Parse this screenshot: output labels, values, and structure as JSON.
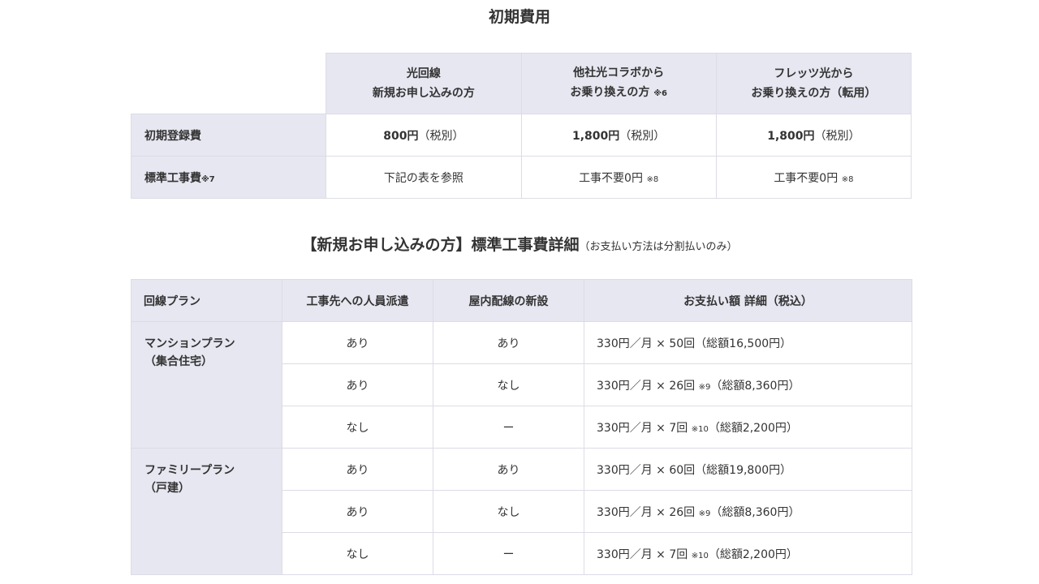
{
  "title": "初期費用",
  "table1": {
    "columns": [
      {
        "line1": "光回線",
        "line2": "新規お申し込みの方",
        "note": ""
      },
      {
        "line1": "他社光コラボから",
        "line2": "お乗り換えの方",
        "note": "※6"
      },
      {
        "line1": "フレッツ光から",
        "line2": "お乗り換えの方（転用）",
        "note": ""
      }
    ],
    "rows": [
      {
        "label": "初期登録費",
        "label_note": "",
        "cells": [
          {
            "main": "800円",
            "suffix": "（税別）",
            "note": ""
          },
          {
            "main": "1,800円",
            "suffix": "（税別）",
            "note": ""
          },
          {
            "main": "1,800円",
            "suffix": "（税別）",
            "note": ""
          }
        ]
      },
      {
        "label": "標準工事費",
        "label_note": "※7",
        "cells": [
          {
            "main": "",
            "suffix": "下記の表を参照",
            "note": ""
          },
          {
            "main": "",
            "suffix": "工事不要0円",
            "note": "※8"
          },
          {
            "main": "",
            "suffix": "工事不要0円",
            "note": "※8"
          }
        ]
      }
    ]
  },
  "section2": {
    "title": "【新規お申し込みの方】標準工事費詳細",
    "subtitle": "（お支払い方法は分割払いのみ）"
  },
  "table2": {
    "headers": [
      "回線プラン",
      "工事先への人員派遣",
      "屋内配線の新設",
      "お支払い額 詳細（税込）"
    ],
    "groups": [
      {
        "plan_line1": "マンションプラン",
        "plan_line2": "（集合住宅）",
        "rows": [
          {
            "dispatch": "あり",
            "wiring": "あり",
            "pay": "330円／月 × 50回",
            "note": "",
            "total": "（総額16,500円）"
          },
          {
            "dispatch": "あり",
            "wiring": "なし",
            "pay": "330円／月 × 26回",
            "note": "※9",
            "total": "（総額8,360円）"
          },
          {
            "dispatch": "なし",
            "wiring": "ー",
            "pay": "330円／月 × 7回",
            "note": "※10",
            "total": "（総額2,200円）"
          }
        ]
      },
      {
        "plan_line1": "ファミリープラン",
        "plan_line2": "（戸建）",
        "rows": [
          {
            "dispatch": "あり",
            "wiring": "あり",
            "pay": "330円／月 × 60回",
            "note": "",
            "total": "（総額19,800円）"
          },
          {
            "dispatch": "あり",
            "wiring": "なし",
            "pay": "330円／月 × 26回",
            "note": "※9",
            "total": "（総額8,360円）"
          },
          {
            "dispatch": "なし",
            "wiring": "ー",
            "pay": "330円／月 × 7回",
            "note": "※10",
            "total": "（総額2,200円）"
          }
        ]
      }
    ]
  }
}
